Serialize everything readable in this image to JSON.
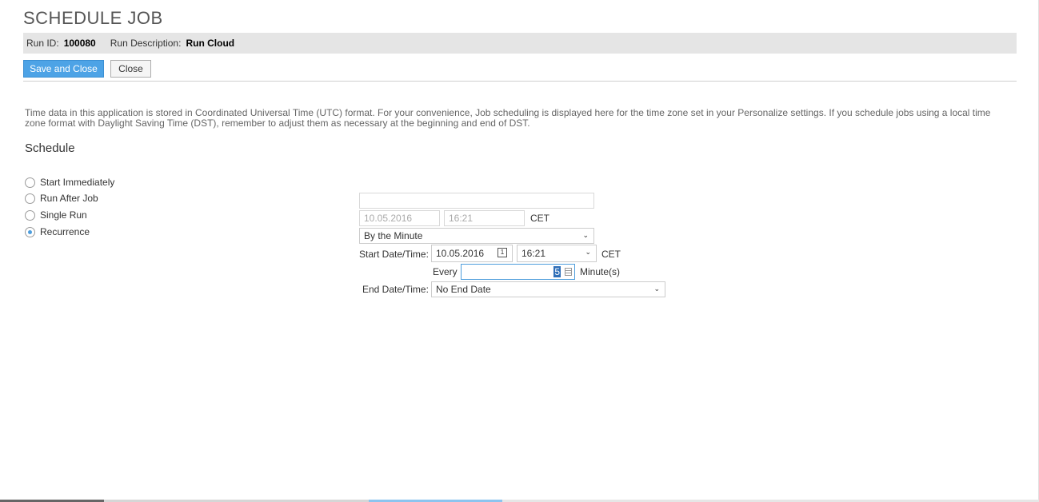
{
  "header": {
    "title": "SCHEDULE JOB",
    "run_id_label": "Run ID:",
    "run_id_value": "100080",
    "run_desc_label": "Run Description:",
    "run_desc_value": "Run Cloud"
  },
  "toolbar": {
    "save_close_label": "Save and Close",
    "close_label": "Close"
  },
  "notice": "Time data in this application is stored in Coordinated Universal Time (UTC) format. For your convenience, Job scheduling is displayed here for the time zone set in your Personalize settings. If you schedule jobs using a local time zone format with Daylight Saving Time (DST), remember to adjust them as necessary at the beginning and end of DST.",
  "schedule": {
    "title": "Schedule",
    "options": [
      {
        "label": "Start Immediately",
        "selected": false
      },
      {
        "label": "Run After Job",
        "selected": false
      },
      {
        "label": "Single Run",
        "selected": false
      },
      {
        "label": "Recurrence",
        "selected": true
      }
    ],
    "run_after_job_value": "",
    "single_run_date": "10.05.2016",
    "single_run_time": "16:21",
    "single_run_tz": "CET",
    "recurrence_type": "By the Minute",
    "start_label": "Start Date/Time:",
    "start_date": "10.05.2016",
    "start_time": "16:21",
    "start_tz": "CET",
    "every_label": "Every",
    "every_value": "5",
    "every_unit": "Minute(s)",
    "end_label": "End Date/Time:",
    "end_value": "No End Date",
    "calendar_icon_text": "1"
  },
  "colors": {
    "primary_button": "#4da3e6",
    "info_bar": "#e5e5e5",
    "radio_selected": "#4d9ddc"
  }
}
